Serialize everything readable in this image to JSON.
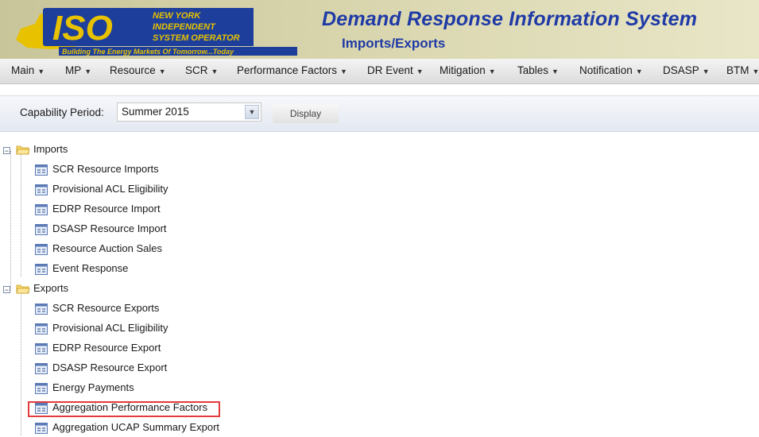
{
  "header": {
    "logo_lines": [
      "NEW YORK",
      "INDEPENDENT",
      "SYSTEM OPERATOR"
    ],
    "logo_big": "ISO",
    "tagline": "Building The Energy Markets Of Tomorrow...Today",
    "title": "Demand Response Information System",
    "subtitle": "Imports/Exports"
  },
  "menu": [
    {
      "label": "Main"
    },
    {
      "label": "MP"
    },
    {
      "label": "Resource"
    },
    {
      "label": "SCR"
    },
    {
      "label": "Performance Factors"
    },
    {
      "label": "DR Event"
    },
    {
      "label": "Mitigation"
    },
    {
      "label": "Tables"
    },
    {
      "label": "Notification"
    },
    {
      "label": "DSASP"
    },
    {
      "label": "BTM"
    }
  ],
  "toolbar": {
    "capability_label": "Capability Period:",
    "capability_value": "Summer 2015",
    "display_label": "Display"
  },
  "tree": {
    "imports": {
      "label": "Imports",
      "items": [
        "SCR Resource Imports",
        "Provisional ACL Eligibility",
        "EDRP Resource Import",
        "DSASP Resource Import",
        "Resource Auction Sales",
        "Event Response"
      ]
    },
    "exports": {
      "label": "Exports",
      "items": [
        "SCR Resource Exports",
        "Provisional ACL Eligibility",
        "EDRP Resource Export",
        "DSASP Resource Export",
        "Energy Payments",
        "Aggregation Performance Factors",
        "Aggregation UCAP Summary Export"
      ]
    }
  },
  "colors": {
    "title_blue": "#1f3aa6",
    "highlight_red": "#e13b3b"
  }
}
